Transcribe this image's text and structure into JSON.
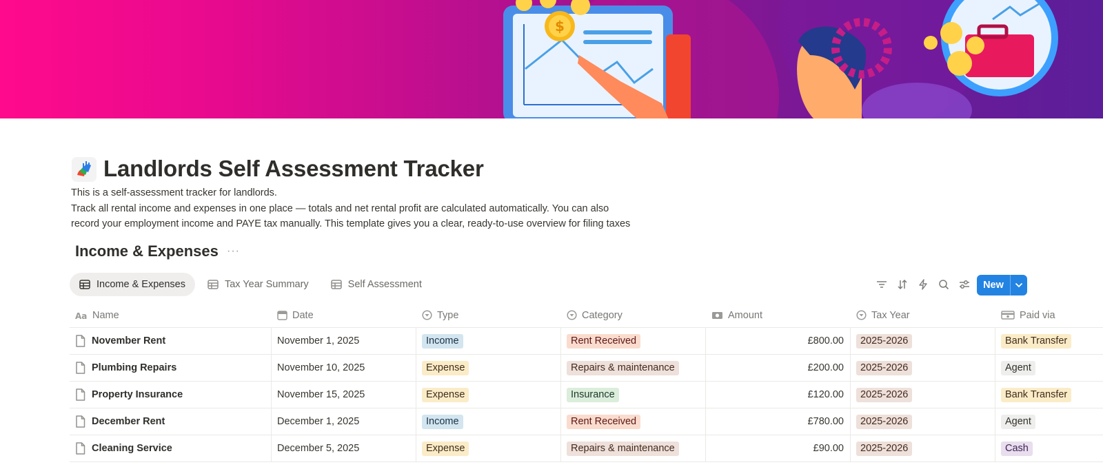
{
  "page": {
    "title": "Landlords Self Assessment Tracker",
    "description": [
      "This is a self-assessment tracker for landlords.",
      "Track all rental income and expenses in one place — totals and net rental profit are calculated automatically. You can also",
      "record your employment income and PAYE tax manually. This template gives you a clear, ready-to-use overview for filing taxes"
    ]
  },
  "database": {
    "title": "Income & Expenses",
    "more": "···",
    "views": [
      {
        "label": "Income & Expenses",
        "icon": "table-icon",
        "active": true
      },
      {
        "label": "Tax Year Summary",
        "icon": "table-icon",
        "active": false
      },
      {
        "label": "Self Assessment",
        "icon": "table-icon",
        "active": false
      }
    ],
    "toolbar": {
      "icons": [
        "filter-icon",
        "sort-icon",
        "automation-icon",
        "search-icon",
        "settings-icon"
      ],
      "new_label": "New"
    },
    "columns": [
      {
        "label": "Name",
        "icon": "text-property-icon"
      },
      {
        "label": "Date",
        "icon": "calendar-icon"
      },
      {
        "label": "Type",
        "icon": "select-icon"
      },
      {
        "label": "Category",
        "icon": "select-icon"
      },
      {
        "label": "Amount",
        "icon": "money-icon"
      },
      {
        "label": "Tax Year",
        "icon": "select-icon"
      },
      {
        "label": "Paid via",
        "icon": "payment-icon"
      }
    ],
    "rows": [
      {
        "name": "November Rent",
        "date": "November 1, 2025",
        "type": "Income",
        "category": "Rent Received",
        "amount": "£800.00",
        "tax_year": "2025-2026",
        "paid_via": "Bank Transfer"
      },
      {
        "name": "Plumbing Repairs",
        "date": "November 10, 2025",
        "type": "Expense",
        "category": "Repairs & maintenance",
        "amount": "£200.00",
        "tax_year": "2025-2026",
        "paid_via": "Agent"
      },
      {
        "name": "Property Insurance",
        "date": "November 15, 2025",
        "type": "Expense",
        "category": "Insurance",
        "amount": "£120.00",
        "tax_year": "2025-2026",
        "paid_via": "Bank Transfer"
      },
      {
        "name": "December Rent",
        "date": "December 1, 2025",
        "type": "Income",
        "category": "Rent Received",
        "amount": "£780.00",
        "tax_year": "2025-2026",
        "paid_via": "Agent"
      },
      {
        "name": "Cleaning Service",
        "date": "December 5, 2025",
        "type": "Expense",
        "category": "Repairs & maintenance",
        "amount": "£90.00",
        "tax_year": "2025-2026",
        "paid_via": "Cash"
      }
    ]
  },
  "tag_colors": {
    "Income": {
      "bg": "#d3e5ef",
      "fg": "#183347"
    },
    "Expense": {
      "bg": "#fbecc8",
      "fg": "#402c1b"
    },
    "Rent Received": {
      "bg": "#fadcce",
      "fg": "#5d1715"
    },
    "Repairs & maintenance": {
      "bg": "#eee0da",
      "fg": "#442a1e"
    },
    "Insurance": {
      "bg": "#dbeddb",
      "fg": "#1c3829"
    },
    "2025-2026": {
      "bg": "#eee0da",
      "fg": "#442a1e"
    },
    "Bank Transfer": {
      "bg": "#fbecc8",
      "fg": "#402c1b"
    },
    "Agent": {
      "bg": "#eeeeec",
      "fg": "#32302c"
    },
    "Cash": {
      "bg": "#e8deee",
      "fg": "#412454"
    }
  },
  "colors": {
    "accent": "#2383e2",
    "cover_start": "#ff0a8c",
    "cover_end": "#5c1e9a"
  }
}
